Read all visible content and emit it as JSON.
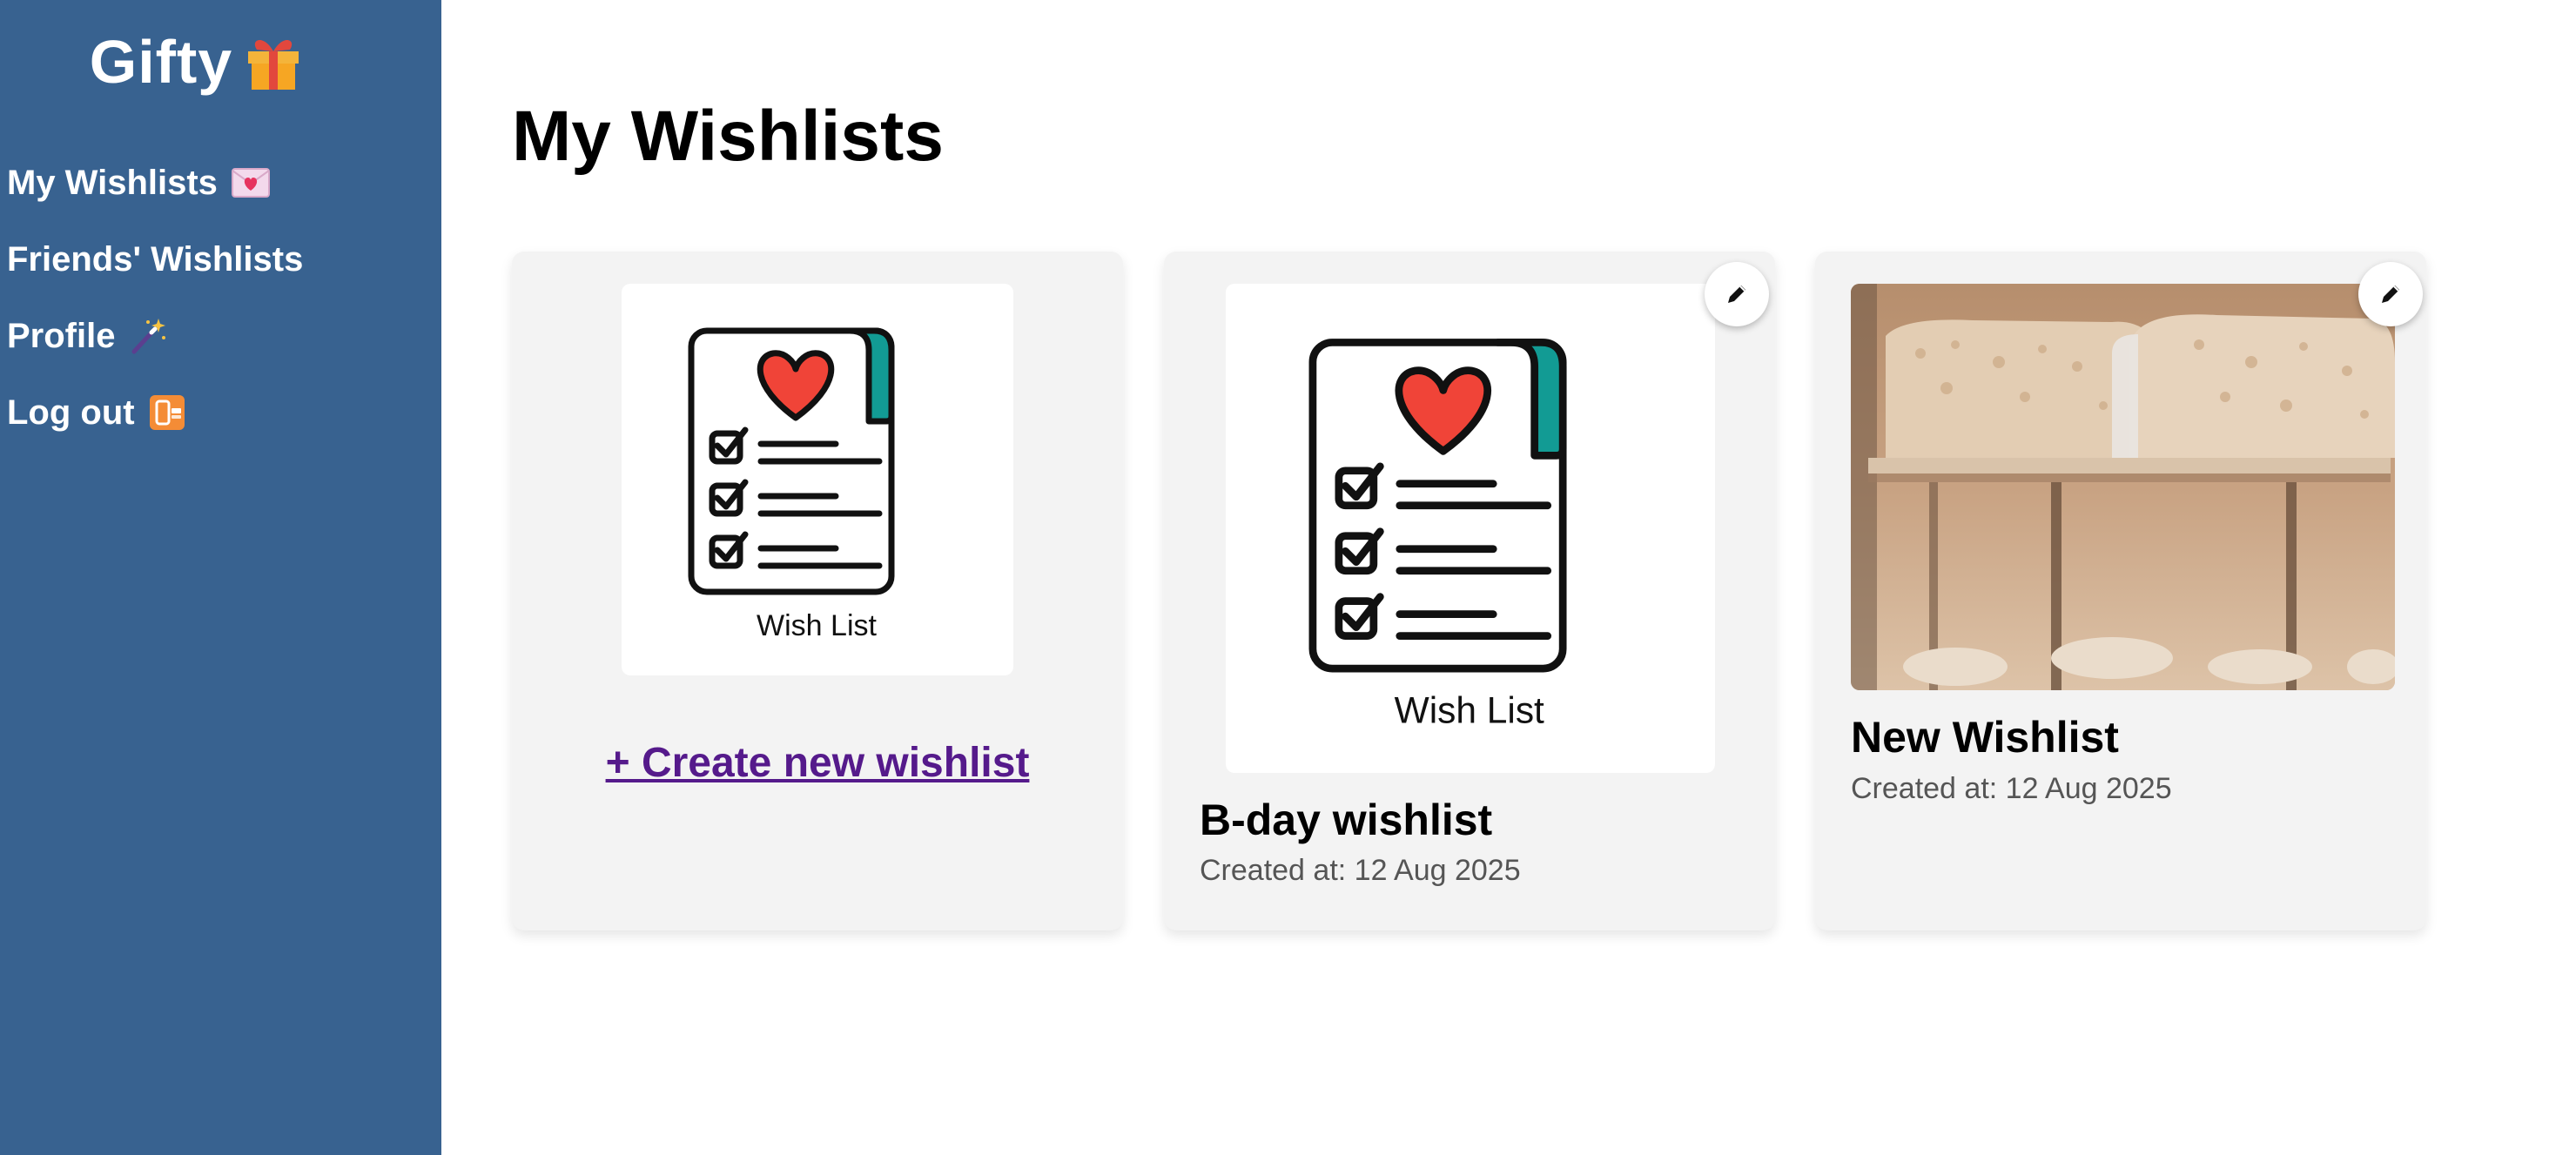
{
  "sidebar": {
    "brand": "Gifty",
    "items": [
      {
        "label": "My Wishlists",
        "icon": "love-letter-icon"
      },
      {
        "label": "Friends' Wishlists",
        "icon": ""
      },
      {
        "label": "Profile",
        "icon": "magic-wand-icon"
      },
      {
        "label": "Log out",
        "icon": "mobile-off-icon"
      }
    ]
  },
  "main": {
    "title": "My Wishlists",
    "create_card": {
      "image_caption": "Wish List",
      "link_label": "+ Create new wishlist"
    },
    "wishlists": [
      {
        "title": "B-day wishlist",
        "created": "Created at: 12 Aug 2025",
        "image_caption": "Wish List"
      },
      {
        "title": "New Wishlist",
        "created": "Created at: 12 Aug 2025"
      }
    ]
  },
  "colors": {
    "sidebar_bg": "#386290",
    "card_bg": "#f3f3f3",
    "link": "#551a8b",
    "heart": "#f04438",
    "tab": "#129b94"
  }
}
